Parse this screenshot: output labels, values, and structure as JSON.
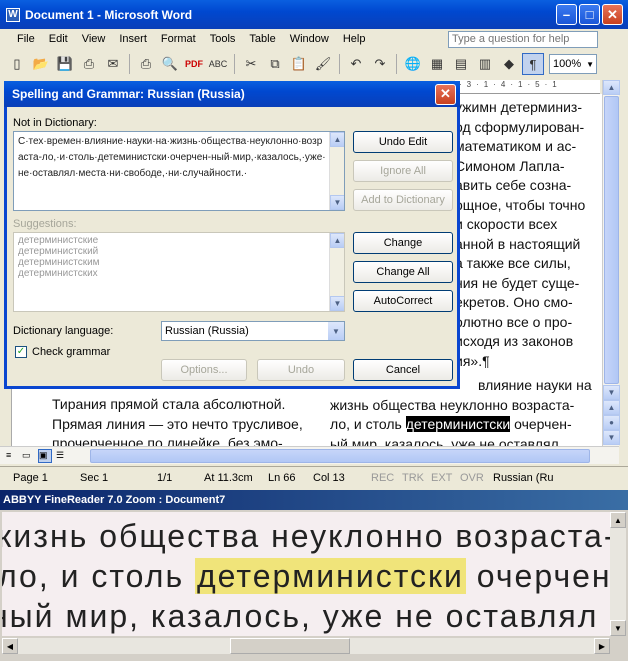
{
  "word": {
    "title": "Document 1 - Microsoft Word",
    "menu": [
      "File",
      "Edit",
      "View",
      "Insert",
      "Format",
      "Tools",
      "Table",
      "Window",
      "Help"
    ],
    "help_placeholder": "Type a question for help",
    "zoom": "100%",
    "doc_right_lines": [
      "ужимн детерминиз-",
      "од сформулирован-",
      "математиком и ас-",
      "Симоном Лапла-",
      "авить себе созна-",
      "ощное, чтобы точно",
      "и скорости всех",
      "анной в настоящий",
      "а также все силы,",
      "ния не будет суще-",
      "екретов. Оно смо-",
      "олютно все о про-",
      "исходя из законов",
      "ия».¶"
    ],
    "doc_lower_left": [
      "Тирания прямой стала абсолютной.",
      "Прямая линия — это нечто трусливое,",
      "прочерченное по линейке, без эмо-"
    ],
    "doc_lower_right": [
      "влияние науки на",
      "жизнь общества неуклонно возраста-",
      "ло, и столь",
      "детерминистски",
      "очерчен-",
      "ый мир, казалось, уже не оставлял"
    ],
    "status": {
      "page": "Page 1",
      "sec": "Sec 1",
      "pages": "1/1",
      "at": "At 11.3cm",
      "ln": "Ln 66",
      "col": "Col 13",
      "rec": "REC",
      "trk": "TRK",
      "ext": "EXT",
      "ovr": "OVR",
      "lang": "Russian (Ru"
    }
  },
  "dialog": {
    "title": "Spelling and Grammar: Russian (Russia)",
    "not_in_dict_label": "Not in Dictionary:",
    "sentence": "С·тех·времен·влияние·науки·на·жизнь·общества·неуклонно·возраста-ло,·и·столь·детеминистски·очерчен-ный·мир,·казалось,·уже·не·оставлял·места·ни·свободе,·ни·случайности.·",
    "suggestions_label": "Suggestions:",
    "suggestions": [
      "детерминистские",
      "детерминистский",
      "детерминистским",
      "детерминистских"
    ],
    "dict_lang_label": "Dictionary language:",
    "dict_lang_value": "Russian (Russia)",
    "check_grammar_label": "Check grammar",
    "buttons": {
      "undo_edit": "Undo Edit",
      "ignore_all": "Ignore All",
      "add_to_dict": "Add to Dictionary",
      "change": "Change",
      "change_all": "Change All",
      "autocorrect": "AutoCorrect",
      "options": "Options...",
      "undo": "Undo",
      "cancel": "Cancel"
    }
  },
  "finereader": {
    "title": "ABBYY FineReader 7.0 Zoom : Document7",
    "lines": [
      {
        "text": "жизнь общества неуклонно возраста-"
      },
      {
        "pre": "ло, и столь ",
        "hl": "детерминистски",
        "post": " очерчен-"
      },
      {
        "text": "ный мир, казалось, уже не оставлял"
      }
    ]
  }
}
